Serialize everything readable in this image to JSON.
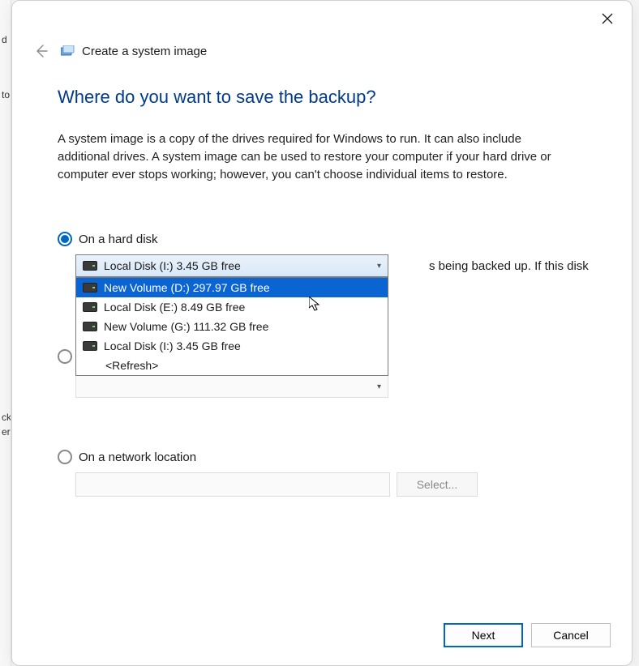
{
  "window": {
    "title": "Create a system image"
  },
  "page": {
    "heading": "Where do you want to save the backup?",
    "description": "A system image is a copy of the drives required for Windows to run. It can also include additional drives. A system image can be used to restore your computer if your hard drive or computer ever stops working; however, you can't choose individual items to restore."
  },
  "options": {
    "hard_disk": {
      "label": "On a hard disk"
    },
    "network": {
      "label": "On a network location"
    }
  },
  "selected_option": "hard_disk",
  "disk_combo": {
    "selected": "Local Disk (I:)  3.45 GB free",
    "items": [
      {
        "label": "New Volume (D:)  297.97 GB free",
        "highlighted": true
      },
      {
        "label": "Local Disk (E:)  8.49 GB free",
        "highlighted": false
      },
      {
        "label": "New Volume (G:)  111.32 GB free",
        "highlighted": false
      },
      {
        "label": "Local Disk (I:)  3.45 GB free",
        "highlighted": false
      }
    ],
    "refresh": "<Refresh>"
  },
  "partial_text_behind_dropdown": "s being backed up. If this disk",
  "network": {
    "select_button": "Select..."
  },
  "buttons": {
    "next": "Next",
    "cancel": "Cancel"
  },
  "left_edge_fragments": [
    "d",
    "to",
    "ck",
    "er"
  ]
}
